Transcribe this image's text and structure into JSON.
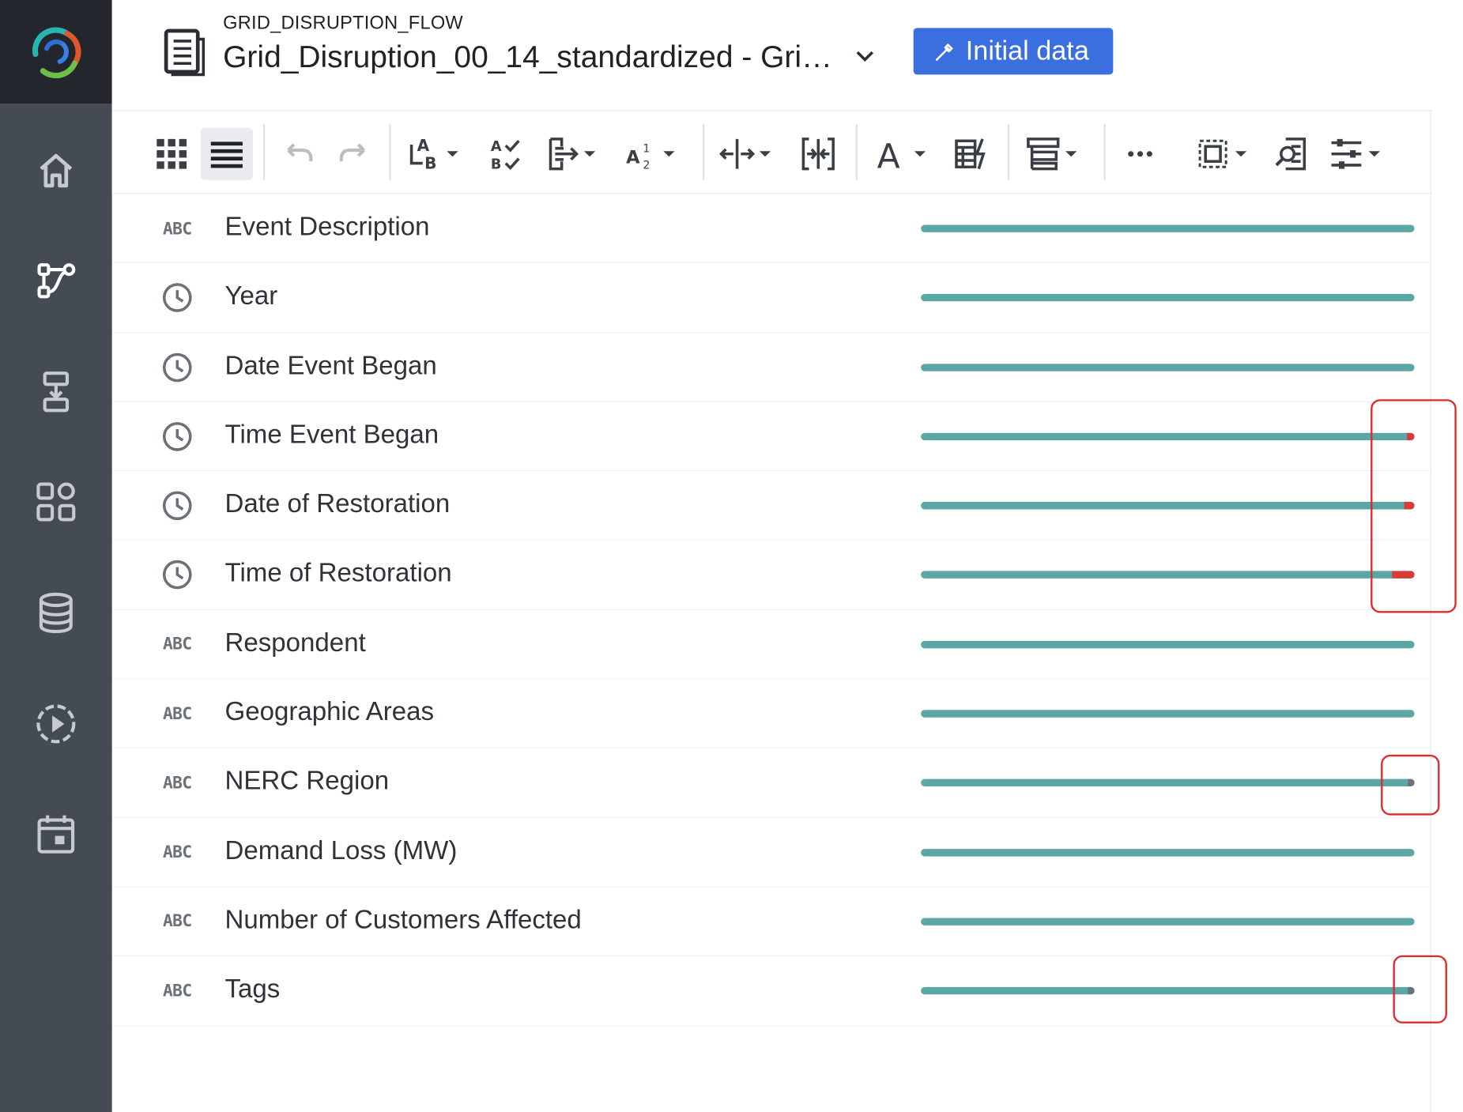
{
  "app": {
    "flow_name": "GRID_DISRUPTION_FLOW",
    "dataset_title": "Grid_Disruption_00_14_standardized - Gri…",
    "primary_button": "Initial data"
  },
  "sidebar": {
    "logo_icon": "app-logo-icon",
    "items": [
      {
        "name": "home",
        "icon": "home-icon"
      },
      {
        "name": "flows",
        "icon": "flow-icon"
      },
      {
        "name": "import",
        "icon": "import-icon"
      },
      {
        "name": "apps",
        "icon": "apps-grid-icon"
      },
      {
        "name": "datasets",
        "icon": "database-icon"
      },
      {
        "name": "runs",
        "icon": "play-circle-icon"
      },
      {
        "name": "schedule",
        "icon": "calendar-icon"
      }
    ]
  },
  "toolbar": {
    "tools": [
      "grid-view-icon",
      "list-view-icon",
      "undo-icon",
      "redo-icon",
      "rename-icon",
      "validate-icon",
      "transform-icon",
      "sort-icon",
      "split-icon",
      "merge-icon",
      "text-format-icon",
      "formula-icon",
      "group-icon",
      "more-icon",
      "select-icon",
      "search-icon",
      "settings-icon"
    ]
  },
  "columns": [
    {
      "name": "Event Description",
      "type": "ABC",
      "invalid_fraction": 0
    },
    {
      "name": "Year",
      "type": "clock",
      "invalid_fraction": 0
    },
    {
      "name": "Date Event Began",
      "type": "clock",
      "invalid_fraction": 0
    },
    {
      "name": "Time Event Began",
      "type": "clock",
      "invalid_fraction": 0.016,
      "invalid_color": "#d93a3a"
    },
    {
      "name": "Date of Restoration",
      "type": "clock",
      "invalid_fraction": 0.02,
      "invalid_color": "#d93a3a"
    },
    {
      "name": "Time of Restoration",
      "type": "clock",
      "invalid_fraction": 0.046,
      "invalid_color": "#d93a3a"
    },
    {
      "name": "Respondent",
      "type": "ABC",
      "invalid_fraction": 0
    },
    {
      "name": "Geographic Areas",
      "type": "ABC",
      "invalid_fraction": 0
    },
    {
      "name": "NERC Region",
      "type": "ABC",
      "invalid_fraction": 0.014,
      "invalid_color": "#6b7178"
    },
    {
      "name": "Demand Loss (MW)",
      "type": "ABC",
      "invalid_fraction": 0
    },
    {
      "name": "Number of Customers Affected",
      "type": "ABC",
      "invalid_fraction": 0
    },
    {
      "name": "Tags",
      "type": "ABC",
      "invalid_fraction": 0.014,
      "invalid_color": "#6b7178"
    }
  ],
  "colors": {
    "accent": "#3b6fe0",
    "valid_bar": "#5ba7a6",
    "highlight": "#e12a2a"
  }
}
